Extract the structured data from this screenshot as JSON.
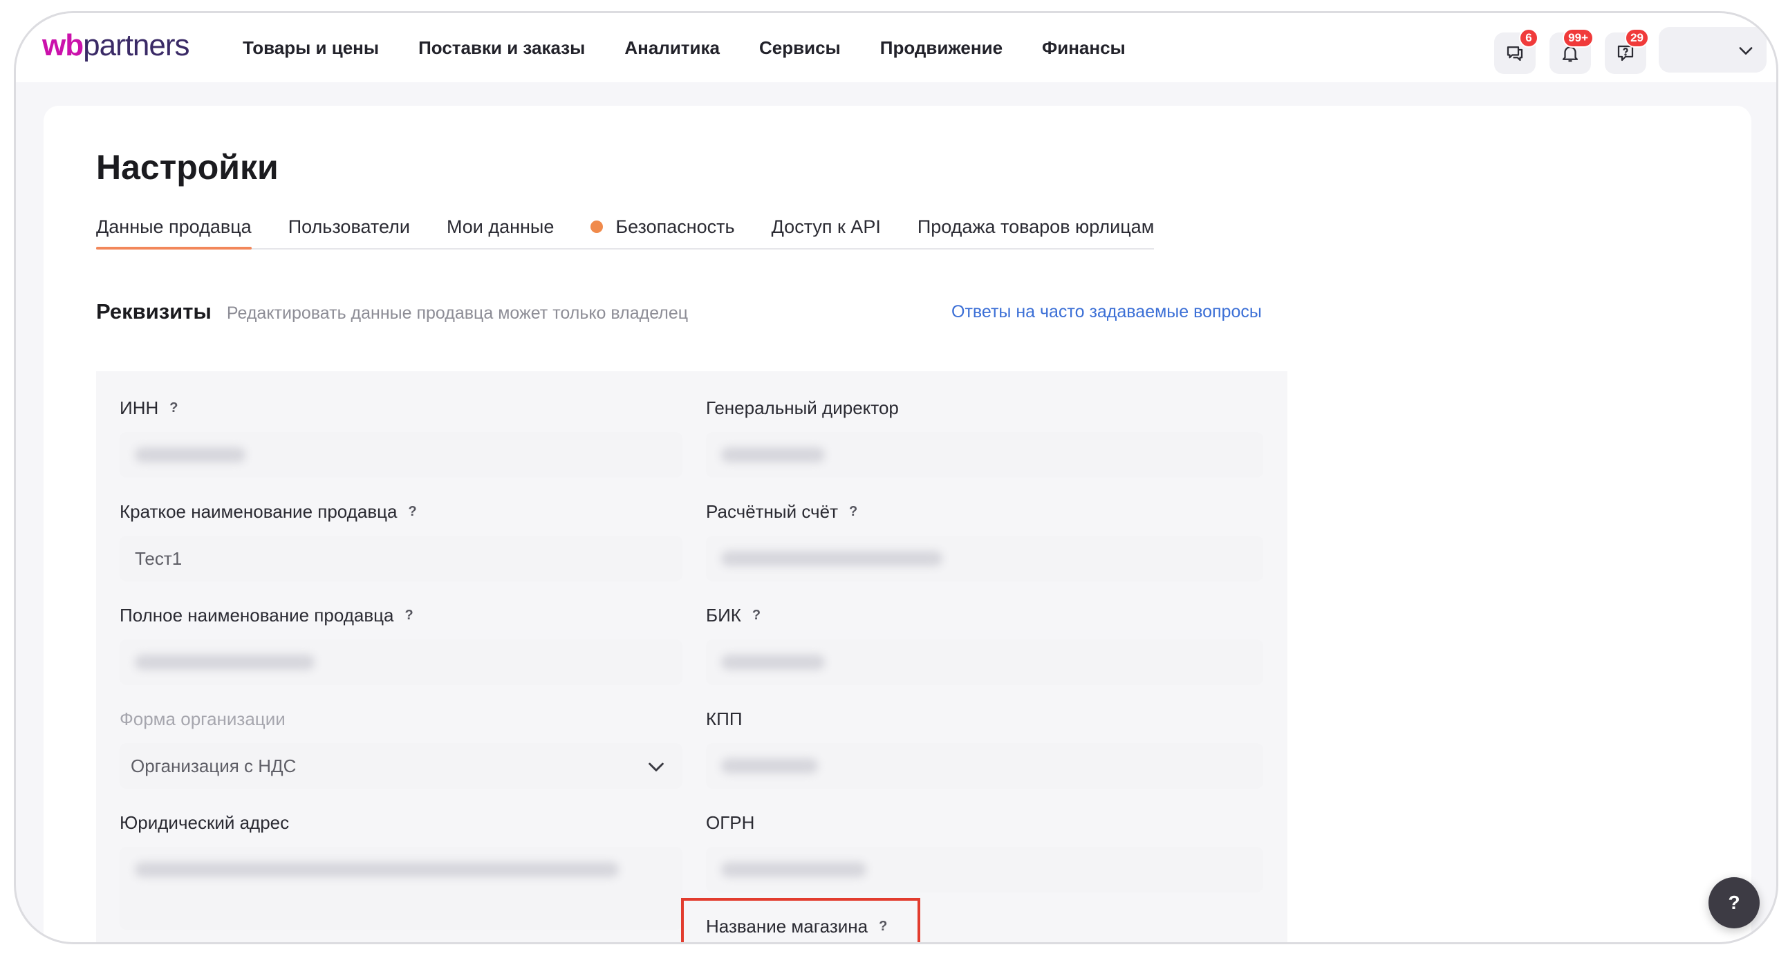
{
  "header": {
    "logo_wb": "wb",
    "logo_partners": "partners",
    "nav": [
      "Товары и цены",
      "Поставки и заказы",
      "Аналитика",
      "Сервисы",
      "Продвижение",
      "Финансы"
    ],
    "chat_badge": "6",
    "notifications_badge": "99+",
    "support_badge": "29"
  },
  "page": {
    "title": "Настройки",
    "tabs": [
      "Данные продавца",
      "Пользователи",
      "Мои данные",
      "Безопасность",
      "Доступ к API",
      "Продажа товаров юрлицам"
    ],
    "active_tab": "Данные продавца"
  },
  "section": {
    "title": "Реквизиты",
    "subtitle": "Редактировать данные продавца может только владелец",
    "faq_link": "Ответы на часто задаваемые вопросы"
  },
  "form": {
    "help_mark": "?",
    "inn_label": "ИНН",
    "director_label": "Генеральный директор",
    "short_name_label": "Краткое наименование продавца",
    "short_name_value": "Тест1",
    "account_label": "Расчётный счёт",
    "full_name_label": "Полное наименование продавца",
    "bik_label": "БИК",
    "org_form_label": "Форма организации",
    "org_form_value": "Организация с НДС",
    "kpp_label": "КПП",
    "address_label": "Юридический адрес",
    "ogrn_label": "ОГРН",
    "shop_name_label": "Название магазина"
  },
  "fab": {
    "label": "?"
  },
  "colors": {
    "brand": "#cb11ab",
    "tab_accent": "#f2875a",
    "link": "#3b6fd6",
    "badge": "#f03a3a",
    "highlight": "#e23c2e"
  }
}
